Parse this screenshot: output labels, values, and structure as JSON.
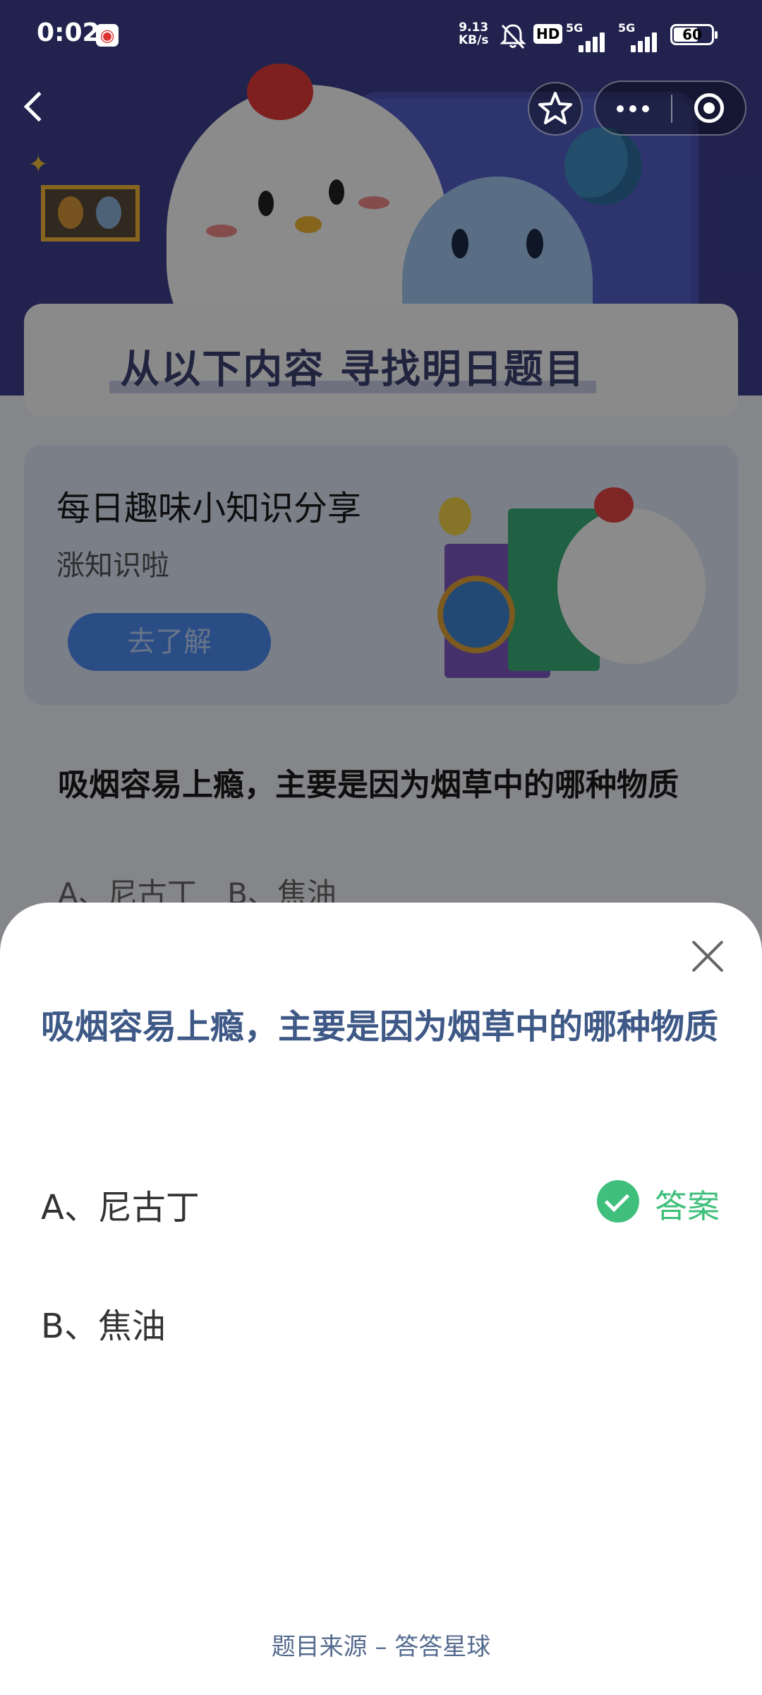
{
  "status_bar": {
    "time": "0:02",
    "net_speed_value": "9.13",
    "net_speed_unit": "KB/s",
    "hd_badge": "HD",
    "signal_1": "5G",
    "signal_2": "5G",
    "battery": "60"
  },
  "banner": {
    "title": "从以下内容 寻找明日题目"
  },
  "share_card": {
    "title": "每日趣味小知识分享",
    "subtitle": "涨知识啦",
    "button": "去了解"
  },
  "question_card": {
    "question": "吸烟容易上瘾，主要是因为烟草中的哪种物质",
    "options_preview": "A、尼古丁 B、焦油"
  },
  "sheet": {
    "question": "吸烟容易上瘾，主要是因为烟草中的哪种物质",
    "options": [
      {
        "label": "A、尼古丁",
        "is_answer": true
      },
      {
        "label": "B、焦油",
        "is_answer": false
      }
    ],
    "answer_label": "答案",
    "source": "题目来源 – 答答星球"
  },
  "colors": {
    "accent_green": "#3fbf7b",
    "question_blue": "#3f5987"
  },
  "icons": [
    "weibo-icon",
    "mute-icon",
    "back-icon",
    "star-icon",
    "more-icon",
    "target-icon",
    "close-icon",
    "check-icon"
  ]
}
